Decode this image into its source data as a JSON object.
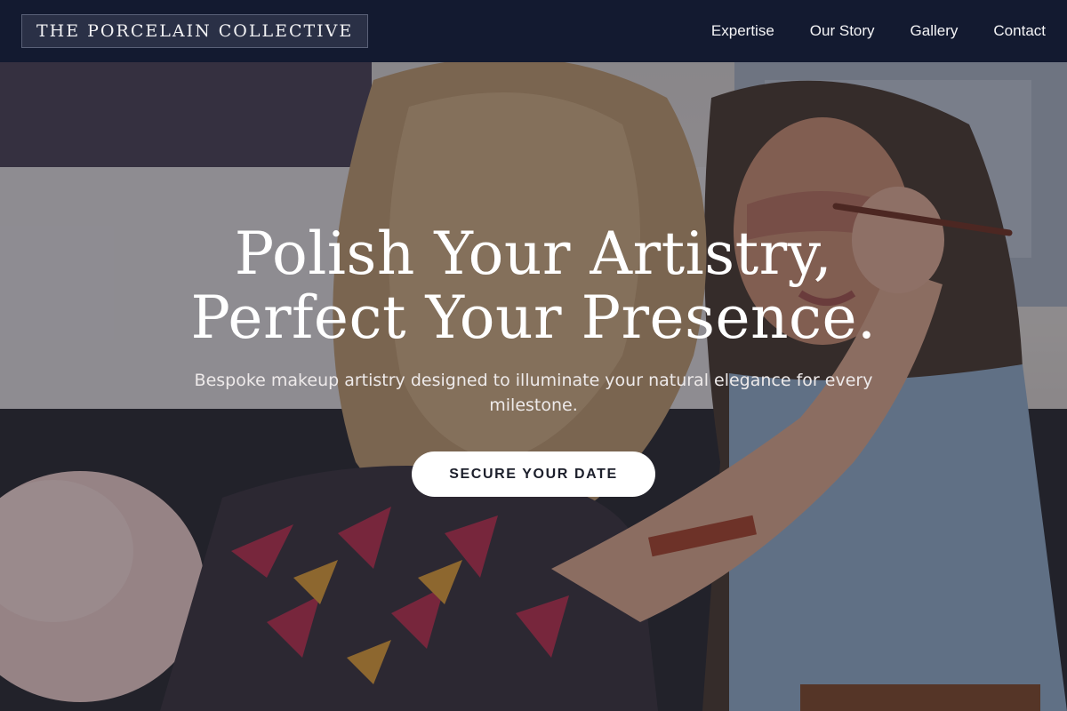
{
  "brand": {
    "name": "THE PORCELAIN COLLECTIVE"
  },
  "nav": {
    "items": [
      {
        "label": "Expertise"
      },
      {
        "label": "Our Story"
      },
      {
        "label": "Gallery"
      },
      {
        "label": "Contact"
      }
    ]
  },
  "hero": {
    "title_line1": "Polish Your Artistry,",
    "title_line2": "Perfect Your Presence.",
    "subtitle": "Bespoke makeup artistry designed to illuminate your natural elegance for every milestone.",
    "cta_label": "SECURE YOUR DATE",
    "image_description_icon": "makeup-session-photo"
  },
  "colors": {
    "header_bg": "#131a30",
    "brand_box_bg": "#2a3046",
    "cta_bg": "#ffffff",
    "cta_text": "#1c1f2b"
  }
}
